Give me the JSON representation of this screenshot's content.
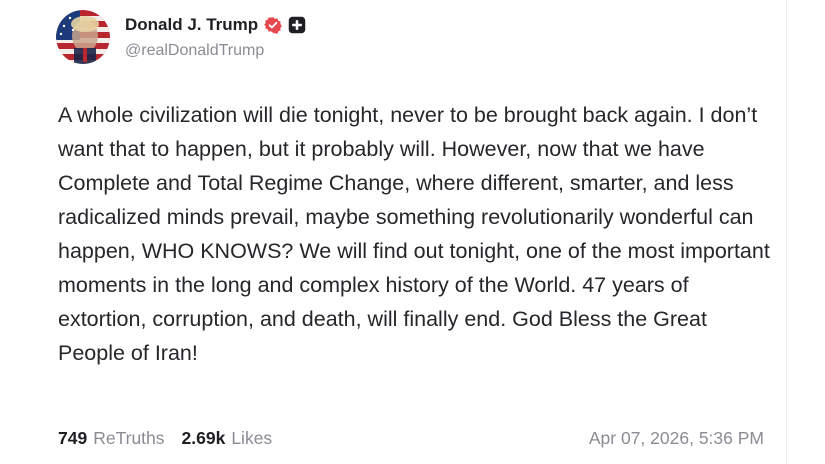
{
  "author": {
    "display_name": "Donald J. Trump",
    "handle": "@realDonaldTrump",
    "verified_icon": "verified-badge-icon",
    "badge_icon": "plus-badge-icon",
    "verified_color": "#e5484d"
  },
  "post": {
    "text": "A whole civilization will die tonight, never to be brought back again. I don’t want that to happen, but it probably will. However, now that we have Complete and Total Regime Change, where different, smarter, and less radicalized minds prevail, maybe something revolutionarily wonderful can happen, WHO KNOWS? We will find out tonight, one of the most important moments in the long and complex history of the World. 47 years of extortion, corruption, and death, will finally end. God Bless the Great People of Iran!"
  },
  "stats": {
    "retruths_count": "749",
    "retruths_label": "ReTruths",
    "likes_count": "2.69k",
    "likes_label": "Likes"
  },
  "timestamp": "Apr 07, 2026, 5:36 PM"
}
